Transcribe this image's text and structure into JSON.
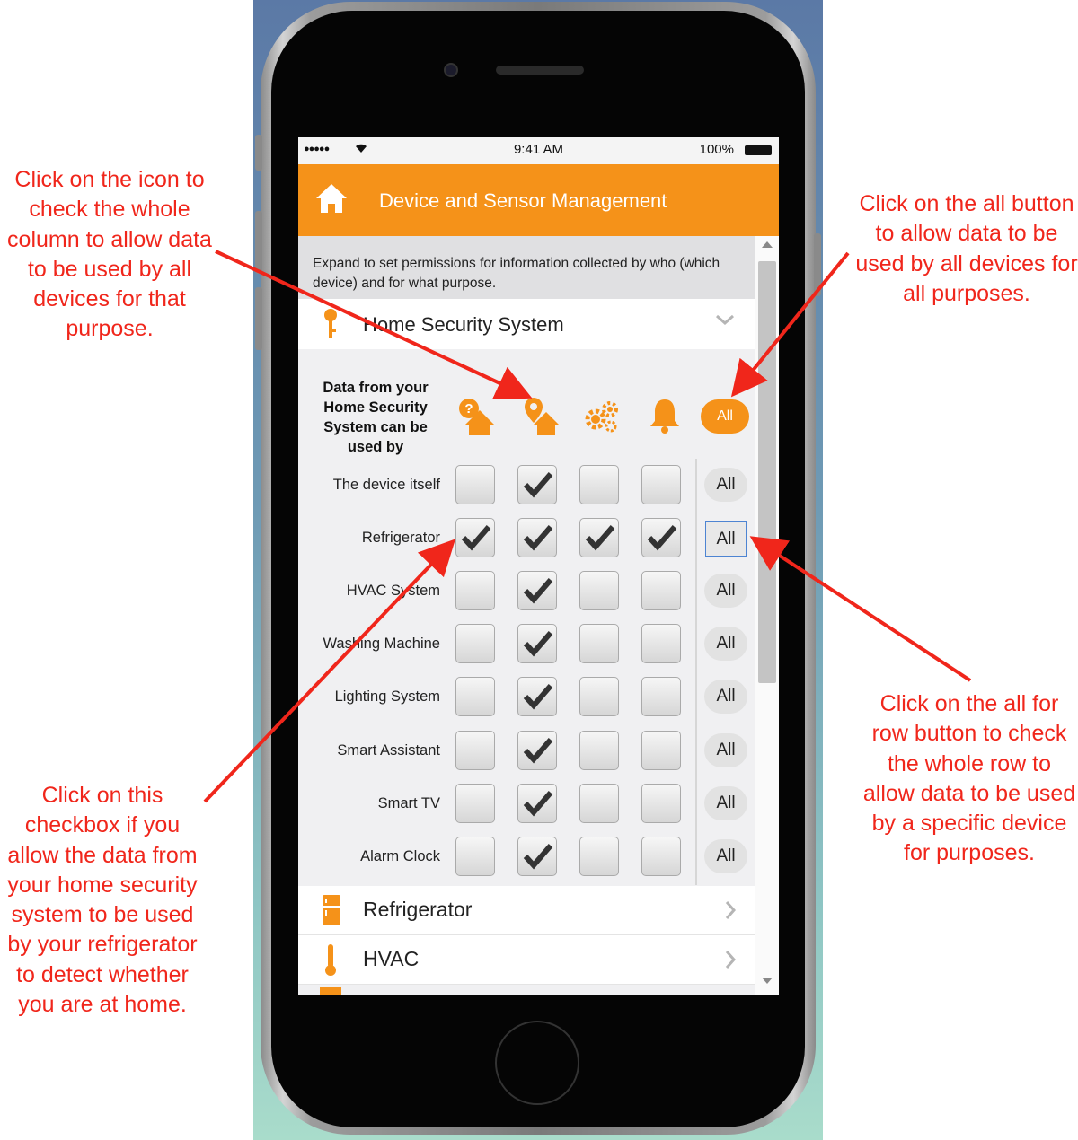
{
  "status_bar": {
    "signal": "●●●●●",
    "time": "9:41 AM",
    "battery": "100%"
  },
  "header": {
    "title": "Device and Sensor Management"
  },
  "intro_text": "Expand to set permissions for information collected by who (which device) and for what purpose.",
  "section": {
    "title": "Home Security System"
  },
  "matrix": {
    "column_header": "Data from your Home Security System can be used by",
    "all_label": "All",
    "purpose_icons": [
      "home-question-icon",
      "home-location-icon",
      "gears-icon",
      "bell-icon"
    ],
    "rows": [
      {
        "device": "The device itself",
        "checks": [
          false,
          true,
          false,
          false
        ]
      },
      {
        "device": "Refrigerator",
        "checks": [
          true,
          true,
          true,
          true
        ]
      },
      {
        "device": "HVAC System",
        "checks": [
          false,
          true,
          false,
          false
        ]
      },
      {
        "device": "Washing Machine",
        "checks": [
          false,
          true,
          false,
          false
        ]
      },
      {
        "device": "Lighting System",
        "checks": [
          false,
          true,
          false,
          false
        ]
      },
      {
        "device": "Smart Assistant",
        "checks": [
          false,
          true,
          false,
          false
        ]
      },
      {
        "device": "Smart TV",
        "checks": [
          false,
          true,
          false,
          false
        ]
      },
      {
        "device": "Alarm Clock",
        "checks": [
          false,
          true,
          false,
          false
        ]
      }
    ]
  },
  "list_items": [
    {
      "label": "Refrigerator",
      "icon": "refrigerator-icon"
    },
    {
      "label": "HVAC",
      "icon": "thermometer-icon"
    }
  ],
  "annotations": {
    "column": "Click on the icon to check the whole column to allow data to be used by all devices for that purpose.",
    "all_button": "Click on the all button to allow data to be used by all devices for all purposes.",
    "row": "Click on the all for row button to check the whole row to allow data to be used by a specific device for purposes.",
    "checkbox": "Click on this checkbox if you allow the data from your home security system to be used by your refrigerator to detect whether you are at home."
  },
  "colors": {
    "accent": "#f59219",
    "annotation": "#f0261b",
    "focus": "#4d84d2"
  }
}
